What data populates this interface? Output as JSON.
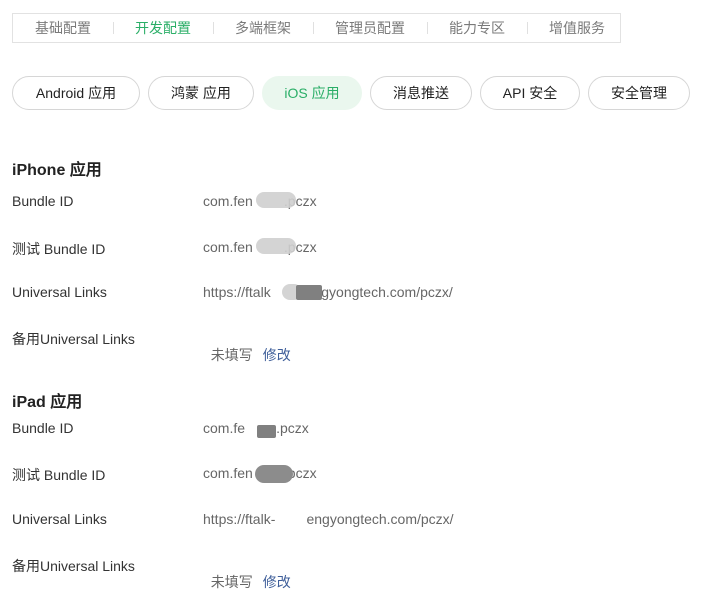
{
  "top_tabs": {
    "items": [
      {
        "label": "基础配置"
      },
      {
        "label": "开发配置"
      },
      {
        "label": "多端框架"
      },
      {
        "label": "管理员配置"
      },
      {
        "label": "能力专区"
      },
      {
        "label": "增值服务"
      }
    ],
    "active_index": 1,
    "colors": {
      "active": "#2aae67",
      "inactive": "#7a7a7a"
    }
  },
  "pills": {
    "items": [
      {
        "label": "Android 应用"
      },
      {
        "label": "鸿蒙 应用"
      },
      {
        "label": "iOS 应用"
      },
      {
        "label": "消息推送"
      },
      {
        "label": "API 安全"
      },
      {
        "label": "安全管理"
      }
    ],
    "active_index": 2,
    "colors": {
      "active_bg": "#eaf7ee",
      "active_text": "#2aae67"
    }
  },
  "iphone": {
    "title": "iPhone 应用",
    "rows": [
      {
        "label": "Bundle ID",
        "value": "com.fen        .pczx"
      },
      {
        "label": "测试 Bundle ID",
        "value": "com.fen        .pczx"
      },
      {
        "label": "Universal Links",
        "value": "https://ftalk         engyongtech.com/pczx/"
      },
      {
        "label": "备用Universal Links",
        "value": "未填写",
        "action": "修改"
      }
    ]
  },
  "ipad": {
    "title": "iPad 应用",
    "rows": [
      {
        "label": "Bundle ID",
        "value": "com.fe        .pczx"
      },
      {
        "label": "测试 Bundle ID",
        "value": "com.fen        .pczx"
      },
      {
        "label": "Universal Links",
        "value": "https://ftalk-        engyongtech.com/pczx/"
      },
      {
        "label": "备用Universal Links",
        "value": "未填写",
        "action": "修改"
      }
    ]
  },
  "colors": {
    "link": "#3f5f9a",
    "redaction": "#808080"
  }
}
